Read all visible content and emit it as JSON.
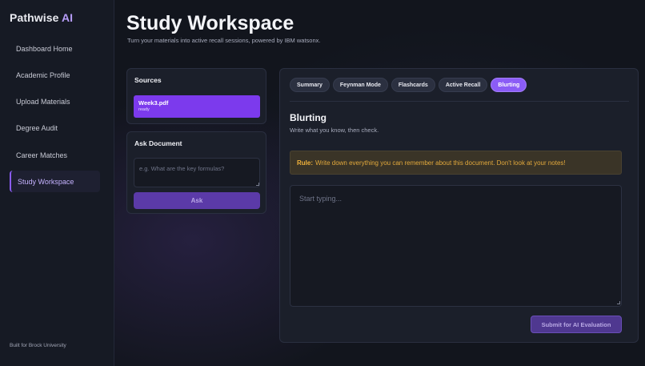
{
  "sidebar": {
    "brand_prefix": "Pathwise ",
    "brand_accent": "AI",
    "nav": [
      {
        "label": "Dashboard Home",
        "active": false
      },
      {
        "label": "Academic Profile",
        "active": false
      },
      {
        "label": "Upload Materials",
        "active": false
      },
      {
        "label": "Degree Audit",
        "active": false
      },
      {
        "label": "Career Matches",
        "active": false
      },
      {
        "label": "Study Workspace",
        "active": true
      }
    ],
    "footer": "Built for Brock University"
  },
  "header": {
    "title": "Study Workspace",
    "subtitle": "Turn your materials into active recall sessions, powered by IBM watsonx."
  },
  "sources": {
    "title": "Sources",
    "items": [
      {
        "name": "Week3.pdf",
        "status": "ready"
      }
    ]
  },
  "ask_document": {
    "title": "Ask Document",
    "placeholder": "e.g. What are the key formulas?",
    "button_label": "Ask"
  },
  "workspace": {
    "tabs": [
      {
        "label": "Summary",
        "active": false
      },
      {
        "label": "Feynman Mode",
        "active": false
      },
      {
        "label": "Flashcards",
        "active": false
      },
      {
        "label": "Active Recall",
        "active": false
      },
      {
        "label": "Blurting",
        "active": true
      }
    ],
    "section_title": "Blurting",
    "section_subtitle": "Write what you know, then check.",
    "rule_label": "Rule:",
    "rule_text": "Write down everything you can remember about this document. Don't look at your notes!",
    "answer_placeholder": "Start typing...",
    "submit_label": "Submit for AI Evaluation"
  },
  "colors": {
    "accent": "#8b5cf6",
    "brand_accent": "#b69cf7",
    "rule_text": "#e3a93c",
    "background": "#12151d"
  }
}
